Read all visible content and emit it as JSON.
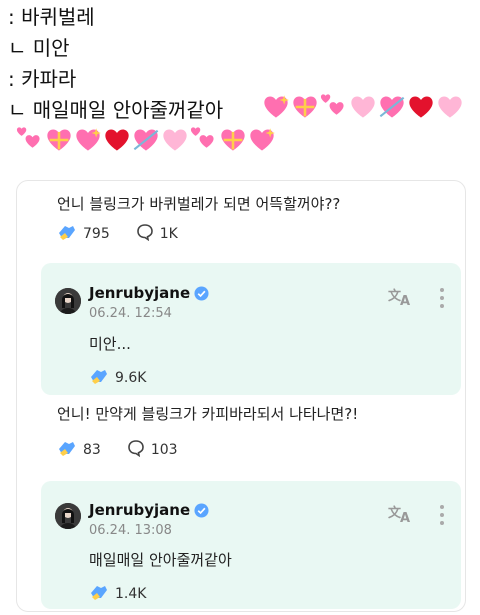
{
  "caption": {
    "lines": [
      ": 바퀴벌레",
      "ㄴ 미안",
      ": 카파라",
      "ㄴ 매일매일 안아줄꺼같아"
    ]
  },
  "colors": {
    "reply_bg": "#e9f8f3",
    "heart_pink": "#ff6fb0",
    "heart_red": "#e3122d",
    "verified": "#5aa5ff",
    "cheer_blue": "#5aa5ff",
    "cheer_yellow": "#ffcf4a"
  },
  "emoji_rows": [
    [
      "sparkling-heart",
      "heart-with-ribbon",
      "two-hearts",
      "pink-heart",
      "heart-with-arrow",
      "red-heart",
      "pink-heart"
    ],
    [
      "two-hearts",
      "heart-with-ribbon",
      "sparkling-heart",
      "red-heart",
      "heart-with-arrow",
      "pink-heart",
      "two-hearts",
      "heart-with-ribbon",
      "sparkling-heart"
    ]
  ],
  "threads": [
    {
      "question": "언니 블링크가 바퀴벌레가 되면 어뜩할꺼야??",
      "cheers": "795",
      "comments": "1K",
      "reply": {
        "name": "Jenrubyjane",
        "date": "06.24. 12:54",
        "message": "미안...",
        "cheers": "9.6K"
      }
    },
    {
      "question": "언니! 만약게 블링크가 카피바라되서 나타나면?!",
      "cheers": "83",
      "comments": "103",
      "reply": {
        "name": "Jenrubyjane",
        "date": "06.24. 13:08",
        "message": "매일매일 안아줄꺼같아",
        "cheers": "1.4K"
      }
    }
  ],
  "icons": {
    "cheer": "cheer-hand-icon",
    "comment": "comment-bubble-icon",
    "verified": "verified-badge-icon",
    "translate": "translate-icon",
    "more": "more-vertical-icon"
  }
}
